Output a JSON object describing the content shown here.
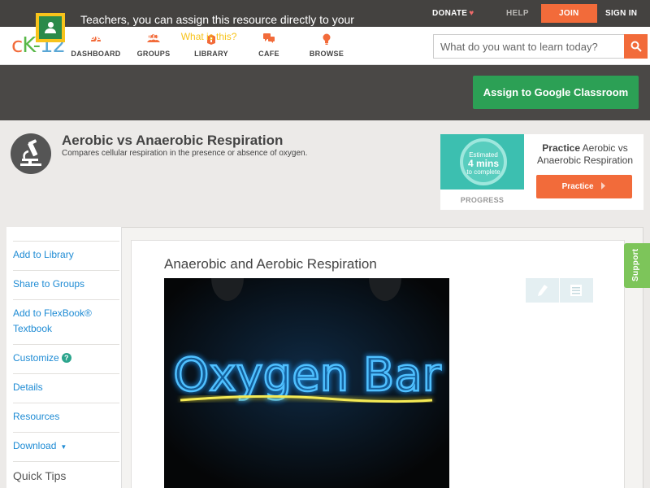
{
  "topbar": {
    "donate": "DONATE",
    "help": "HELP",
    "join": "JOIN",
    "signin": "SIGN IN"
  },
  "logo": {
    "c": "c",
    "k": "K",
    "dash": "-",
    "n": "12"
  },
  "nav": {
    "dashboard": "DASHBOARD",
    "groups": "GROUPS",
    "library": "LIBRARY",
    "cafe": "CAFE",
    "browse": "BROWSE"
  },
  "search": {
    "placeholder": "What do you want to learn today?"
  },
  "classroom": {
    "message": "Teachers, you can assign this resource directly to your Google Classroom!",
    "what": "What is this?",
    "button": "Assign to Google Classroom"
  },
  "header": {
    "title": "Aerobic vs Anaerobic Respiration",
    "subtitle": "Compares cellular respiration in the presence or absence of oxygen."
  },
  "practice": {
    "estimated": "Estimated",
    "mins": "4 mins",
    "complete": "to complete",
    "progress": "PROGRESS",
    "title_bold": "Practice",
    "title_rest": "Aerobic vs Anaerobic Respiration",
    "button": "Practice"
  },
  "sidebar": {
    "items": [
      "Add to Library",
      "Share to Groups",
      "Add to FlexBook® Textbook",
      "Customize",
      "Details",
      "Resources",
      "Download"
    ],
    "quick_tips": "Quick Tips"
  },
  "content": {
    "title": "Anaerobic and Aerobic Respiration",
    "image_text": "Oxygen Bar"
  },
  "support": "Support",
  "colors": {
    "accent": "#f26b3a",
    "google_green": "#2ca055",
    "link": "#1e8bd4",
    "support": "#7dc55a",
    "neon_blue": "#1a9bff",
    "neon_yellow": "#f2e12a"
  }
}
